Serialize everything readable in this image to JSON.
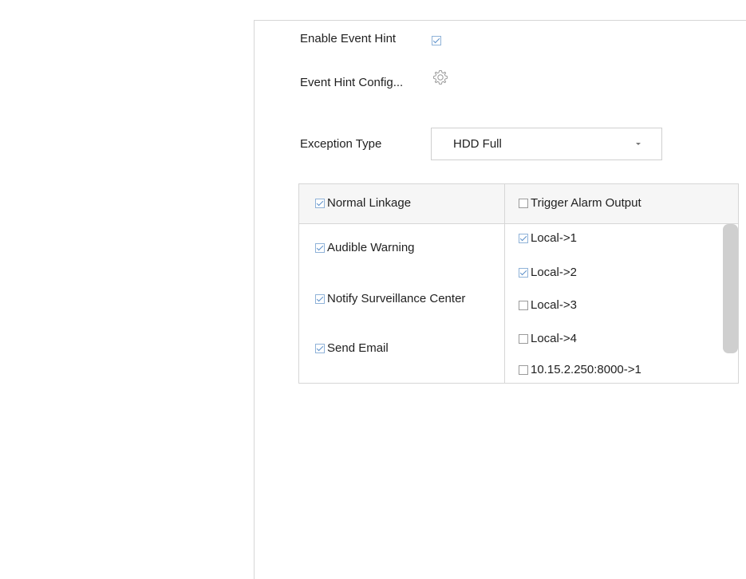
{
  "event_hint": {
    "enable_label": "Enable Event Hint",
    "enable_checked": true,
    "config_label": "Event Hint Config..."
  },
  "exception": {
    "label": "Exception Type",
    "selected": "HDD Full"
  },
  "linkage": {
    "normal_header": "Normal Linkage",
    "normal_header_checked": true,
    "trigger_header": "Trigger Alarm Output",
    "trigger_header_checked": false,
    "normal_items": [
      {
        "label": "Audible Warning",
        "checked": true
      },
      {
        "label": "Notify Surveillance Center",
        "checked": true
      },
      {
        "label": "Send Email",
        "checked": true
      }
    ],
    "trigger_items": [
      {
        "label": "Local->1",
        "checked": true
      },
      {
        "label": "Local->2",
        "checked": true
      },
      {
        "label": "Local->3",
        "checked": false
      },
      {
        "label": "Local->4",
        "checked": false
      },
      {
        "label": "10.15.2.250:8000->1",
        "checked": false
      }
    ]
  },
  "icons": {
    "config": "gear-icon",
    "dropdown": "caret-down-icon"
  }
}
